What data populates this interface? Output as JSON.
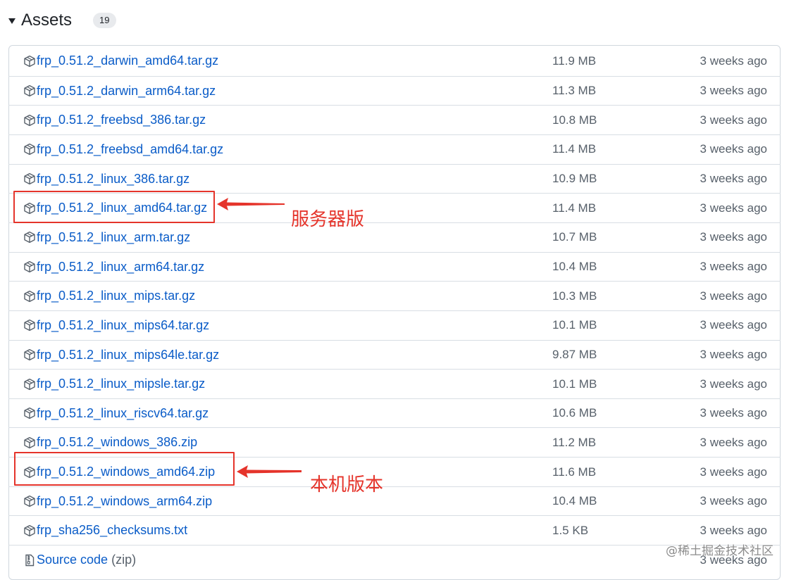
{
  "header": {
    "title": "Assets",
    "count": "19"
  },
  "assets": [
    {
      "name": "frp_0.51.2_darwin_amd64.tar.gz",
      "size": "11.9 MB",
      "time": "3 weeks ago"
    },
    {
      "name": "frp_0.51.2_darwin_arm64.tar.gz",
      "size": "11.3 MB",
      "time": "3 weeks ago"
    },
    {
      "name": "frp_0.51.2_freebsd_386.tar.gz",
      "size": "10.8 MB",
      "time": "3 weeks ago"
    },
    {
      "name": "frp_0.51.2_freebsd_amd64.tar.gz",
      "size": "11.4 MB",
      "time": "3 weeks ago"
    },
    {
      "name": "frp_0.51.2_linux_386.tar.gz",
      "size": "10.9 MB",
      "time": "3 weeks ago"
    },
    {
      "name": "frp_0.51.2_linux_amd64.tar.gz",
      "size": "11.4 MB",
      "time": "3 weeks ago"
    },
    {
      "name": "frp_0.51.2_linux_arm.tar.gz",
      "size": "10.7 MB",
      "time": "3 weeks ago"
    },
    {
      "name": "frp_0.51.2_linux_arm64.tar.gz",
      "size": "10.4 MB",
      "time": "3 weeks ago"
    },
    {
      "name": "frp_0.51.2_linux_mips.tar.gz",
      "size": "10.3 MB",
      "time": "3 weeks ago"
    },
    {
      "name": "frp_0.51.2_linux_mips64.tar.gz",
      "size": "10.1 MB",
      "time": "3 weeks ago"
    },
    {
      "name": "frp_0.51.2_linux_mips64le.tar.gz",
      "size": "9.87 MB",
      "time": "3 weeks ago"
    },
    {
      "name": "frp_0.51.2_linux_mipsle.tar.gz",
      "size": "10.1 MB",
      "time": "3 weeks ago"
    },
    {
      "name": "frp_0.51.2_linux_riscv64.tar.gz",
      "size": "10.6 MB",
      "time": "3 weeks ago"
    },
    {
      "name": "frp_0.51.2_windows_386.zip",
      "size": "11.2 MB",
      "time": "3 weeks ago"
    },
    {
      "name": "frp_0.51.2_windows_amd64.zip",
      "size": "11.6 MB",
      "time": "3 weeks ago"
    },
    {
      "name": "frp_0.51.2_windows_arm64.zip",
      "size": "10.4 MB",
      "time": "3 weeks ago"
    },
    {
      "name": "frp_sha256_checksums.txt",
      "size": "1.5 KB",
      "time": "3 weeks ago"
    }
  ],
  "source_code": {
    "label": "Source code",
    "format": "(zip)",
    "time": "3 weeks ago"
  },
  "annotations": {
    "server_label": "服务器版",
    "local_label": "本机版本",
    "color": "#e5342b"
  },
  "watermark": "@稀土掘金技术社区",
  "colors": {
    "link": "#0a5cc8",
    "muted": "#57606a",
    "border": "#d0d7de"
  }
}
